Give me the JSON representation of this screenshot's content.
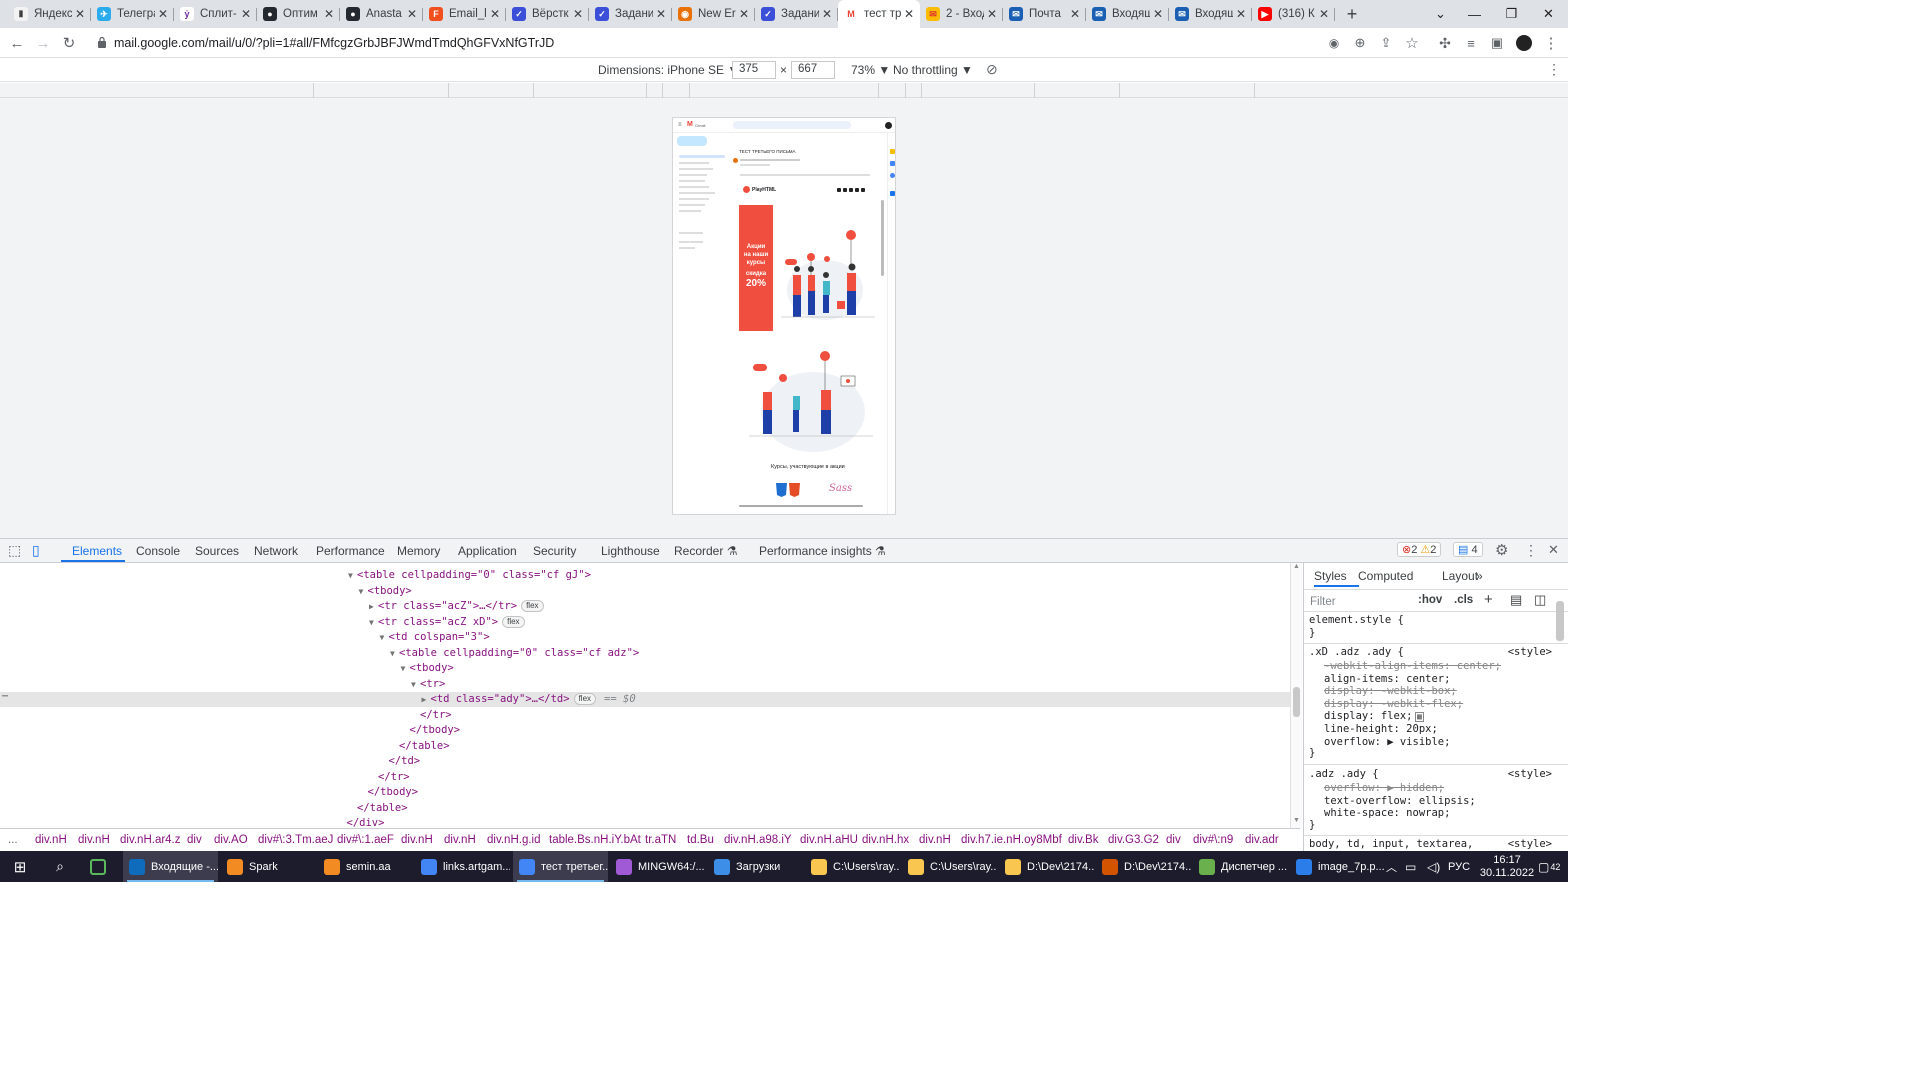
{
  "browser": {
    "tabs": [
      {
        "title": "Яндекс",
        "color": "#f3f3f3",
        "glyph": "Ⅱ",
        "glyph_color": "#000"
      },
      {
        "title": "Телеграм",
        "color": "#2aabee",
        "glyph": "✈",
        "glyph_color": "#fff"
      },
      {
        "title": "Сплит-",
        "color": "#fff",
        "glyph": "ỷ",
        "glyph_color": "#6b2ca4"
      },
      {
        "title": "Оптим",
        "color": "#24292f",
        "glyph": "●",
        "glyph_color": "#fff"
      },
      {
        "title": "Anasta",
        "color": "#24292f",
        "glyph": "●",
        "glyph_color": "#fff"
      },
      {
        "title": "Email_l",
        "color": "#f24e1e",
        "glyph": "F",
        "glyph_color": "#fff"
      },
      {
        "title": "Вёрстк",
        "color": "#3c4fd8",
        "glyph": "✓",
        "glyph_color": "#fff"
      },
      {
        "title": "Задани",
        "color": "#3c4fd8",
        "glyph": "✓",
        "glyph_color": "#fff"
      },
      {
        "title": "New Er",
        "color": "#e8710a",
        "glyph": "◉",
        "glyph_color": "#fff"
      },
      {
        "title": "Задани",
        "color": "#3c4fd8",
        "glyph": "✓",
        "glyph_color": "#fff"
      },
      {
        "title": "тест тр",
        "color": "#ffffff",
        "glyph": "M",
        "glyph_color": "#ea4335",
        "active": true
      },
      {
        "title": "2 - Вход",
        "color": "#fbbc04",
        "glyph": "✉",
        "glyph_color": "#d33"
      },
      {
        "title": "Почта",
        "color": "#1a5fb4",
        "glyph": "✉",
        "glyph_color": "#fff"
      },
      {
        "title": "Входящ",
        "color": "#1a5fb4",
        "glyph": "✉",
        "glyph_color": "#fff"
      },
      {
        "title": "Входящ",
        "color": "#1a5fb4",
        "glyph": "✉",
        "glyph_color": "#fff"
      },
      {
        "title": "(316) К",
        "color": "#ff0000",
        "glyph": "▶",
        "glyph_color": "#fff"
      }
    ],
    "close_glyph": "✕",
    "new_tab_glyph": "+",
    "url": "mail.google.com/mail/u/0/?pli=1#all/FMfcgzGrbJBFJWmdTmdQhGFVxNfGTrJD"
  },
  "device_toolbar": {
    "dimensions_label": "Dimensions: iPhone SE ▼",
    "width": "375",
    "times": "×",
    "height": "667",
    "zoom": "73% ▼",
    "throttling": "No throttling ▼"
  },
  "email": {
    "subject": "ТЕСТ ТРЕТЬЕГО ПИСЬМА",
    "brand": "PlayHTML",
    "banner_line1": "Акции",
    "banner_line2": "на наши",
    "banner_line3": "курсы",
    "banner_line4": "скидка",
    "banner_percent": "20%",
    "courses_caption": "Курсы, участвующие в акции",
    "sass_label": "Sass",
    "gmail_label": "Gmail"
  },
  "devtools": {
    "tabs": [
      "Elements",
      "Console",
      "Sources",
      "Network",
      "Performance",
      "Memory",
      "Application",
      "Security",
      "Lighthouse",
      "Recorder ⚗",
      "Performance insights ⚗"
    ],
    "errors": "2",
    "warnings": "2",
    "messages": "4",
    "dom_lines": [
      {
        "indent": 0,
        "tri": "▼",
        "html": "<table cellpadding=\"0\" class=\"cf gJ\">"
      },
      {
        "indent": 1,
        "tri": "▼",
        "html": "<tbody>"
      },
      {
        "indent": 2,
        "tri": "▶",
        "html": "<tr class=\"acZ\">…</tr>",
        "badge": "flex"
      },
      {
        "indent": 2,
        "tri": "▼",
        "html": "<tr class=\"acZ xD\">",
        "badge": "flex"
      },
      {
        "indent": 3,
        "tri": "▼",
        "html": "<td colspan=\"3\">"
      },
      {
        "indent": 4,
        "tri": "▼",
        "html": "<table cellpadding=\"0\" class=\"cf adz\">"
      },
      {
        "indent": 5,
        "tri": "▼",
        "html": "<tbody>"
      },
      {
        "indent": 6,
        "tri": "▼",
        "html": "<tr>"
      },
      {
        "indent": 7,
        "tri": "▶",
        "html": "<td class=\"ady\">…</td>",
        "badge": "flex",
        "selected": true,
        "suffix": "== $0"
      },
      {
        "indent": 6,
        "tri": "",
        "html": "</tr>"
      },
      {
        "indent": 5,
        "tri": "",
        "html": "</tbody>"
      },
      {
        "indent": 4,
        "tri": "",
        "html": "</table>"
      },
      {
        "indent": 3,
        "tri": "",
        "html": "</td>"
      },
      {
        "indent": 2,
        "tri": "",
        "html": "</tr>"
      },
      {
        "indent": 1,
        "tri": "",
        "html": "</tbody>"
      },
      {
        "indent": 0,
        "tri": "",
        "html": "</table>"
      },
      {
        "indent": -1,
        "tri": "",
        "html": "</div>"
      }
    ],
    "breadcrumbs": [
      "...",
      "div.nH",
      "div.nH",
      "div.nH.ar4.z",
      "div",
      "div.AO",
      "div#\\:3.Tm.aeJ",
      "div#\\:1.aeF",
      "div.nH",
      "div.nH",
      "div.nH.g.id",
      "table.Bs.nH.iY.bAt",
      "tr.aTN",
      "td.Bu",
      "div.nH.a98.iY",
      "div.nH.aHU",
      "div.nH.hx",
      "div.nH",
      "div.h7.ie.nH.oy8Mbf",
      "div.Bk",
      "div.G3.G2",
      "div",
      "div#\\:n9",
      "div.adr"
    ],
    "styles_tabs": [
      "Styles",
      "Computed",
      "Layout",
      "»"
    ],
    "filter_placeholder": "Filter",
    "hov": ":hov",
    "cls": ".cls",
    "element_style": "element.style {",
    "close_brace": "}",
    "rule1_selector": ".xD .adz .ady {",
    "rule1_source": "<style>",
    "rule1_props": [
      {
        "text": "-webkit-align-items: center;",
        "struck": true
      },
      {
        "text": "align-items: center;",
        "struck": false
      },
      {
        "text": "display: -webkit-box;",
        "struck": true
      },
      {
        "text": "display: -webkit-flex;",
        "struck": true
      },
      {
        "text": "display: flex;",
        "struck": false
      },
      {
        "text": "line-height: 20px;",
        "struck": false
      },
      {
        "text": "overflow: ▶ visible;",
        "struck": false
      }
    ],
    "rule2_selector": ".adz .ady {",
    "rule2_source": "<style>",
    "rule2_props": [
      {
        "text": "overflow: ▶ hidden;",
        "struck": true
      },
      {
        "text": "text-overflow: ellipsis;",
        "struck": false
      },
      {
        "text": "white-space: nowrap;",
        "struck": false
      }
    ],
    "rule3_selector": "body, td, input, textarea,",
    "rule3_source": "<style>"
  },
  "taskbar": {
    "items": [
      {
        "label": "Входящие -...",
        "color": "#0f6cbd",
        "active": true
      },
      {
        "label": "Spark",
        "color": "#f28b22"
      },
      {
        "label": "semin.aa",
        "color": "#f28b22"
      },
      {
        "label": "links.artgam...",
        "color": "#4285f4"
      },
      {
        "label": "тест третьег...",
        "color": "#4285f4",
        "active": true
      },
      {
        "label": "MINGW64:/...",
        "color": "#a05ad6"
      },
      {
        "label": "Загрузки",
        "color": "#3d8ee6"
      },
      {
        "label": "C:\\Users\\ray...",
        "color": "#f9c74f"
      },
      {
        "label": "C:\\Users\\ray...",
        "color": "#f9c74f"
      },
      {
        "label": "D:\\Dev\\2174...",
        "color": "#f9c74f"
      },
      {
        "label": "D:\\Dev\\2174...",
        "color": "#d35400"
      },
      {
        "label": "Диспетчер ...",
        "color": "#6ab04c"
      },
      {
        "label": "image_7p.p...",
        "color": "#2b7de9"
      }
    ],
    "lang": "РУС",
    "time": "16:17",
    "date": "30.11.2022",
    "notifications": "42"
  }
}
